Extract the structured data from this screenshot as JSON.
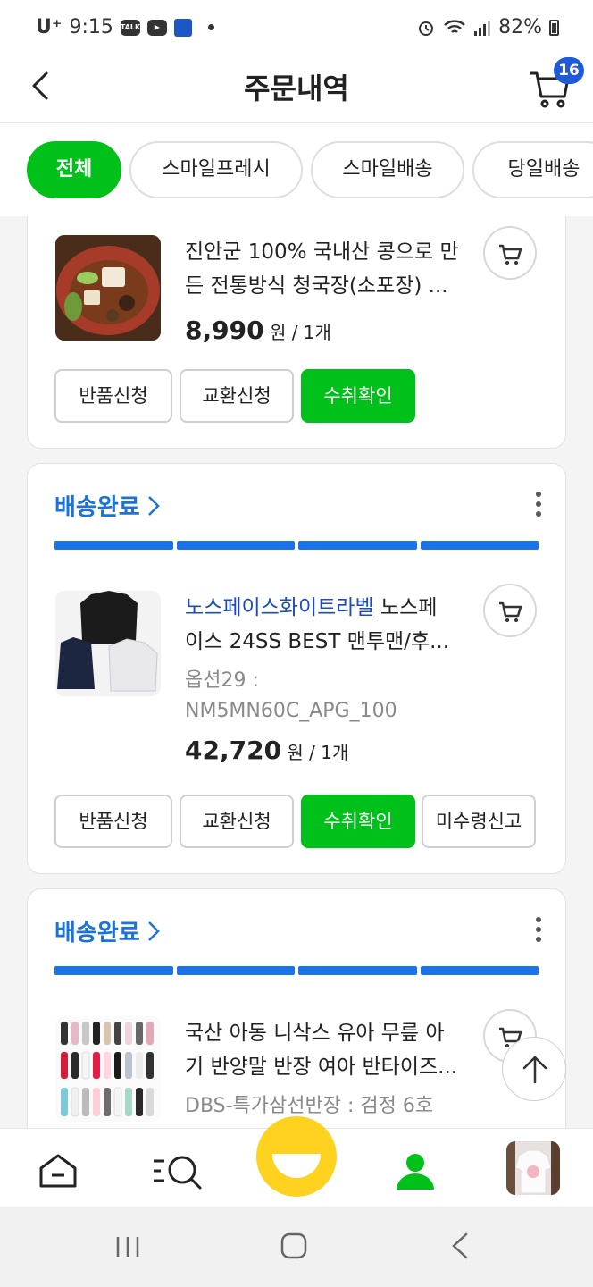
{
  "status_bar": {
    "carrier": "U⁺",
    "time": "9:15",
    "app_icons": [
      "talk-icon",
      "youtube-icon",
      "app-icon"
    ],
    "battery": "82%"
  },
  "header": {
    "title": "주문내역",
    "cart_count": "16"
  },
  "filter_tabs": [
    "전체",
    "스마일프레시",
    "스마일배송",
    "당일배송"
  ],
  "orders": [
    {
      "status": "",
      "title": "진안군 100% 국내산 콩으로 만든 전통방식 청국장(소포장) ...",
      "title_line1": "진안군 100% 국내산 콩으로 만",
      "title_line2": "든 전통방식 청국장(소포장) ...",
      "price": "8,990",
      "price_unit": "원 / 1개",
      "buttons": [
        "반품신청",
        "교환신청",
        "수취확인"
      ]
    },
    {
      "status": "배송완료",
      "brand": "노스페이스화이트라벨",
      "title_line1_rest": " 노스페",
      "title_line2": "이스 24SS BEST 맨투맨/후...",
      "option_line1": "옵션29 :",
      "option_line2": "NM5MN60C_APG_100",
      "price": "42,720",
      "price_unit": "원 / 1개",
      "buttons": [
        "반품신청",
        "교환신청",
        "수취확인",
        "미수령신고"
      ]
    },
    {
      "status": "배송완료",
      "title_line1": "국산 아동 니삭스 유아 무릎 아",
      "title_line2": "기 반양말 반장 여아 반타이즈...",
      "option_line1": "DBS-특가삼선반장 : 검정 6호"
    }
  ],
  "colors": {
    "accent_green": "#00c119",
    "link_blue": "#1a73d8",
    "badge_blue": "#1f5ad7",
    "smile_yellow": "#ffd21f"
  }
}
